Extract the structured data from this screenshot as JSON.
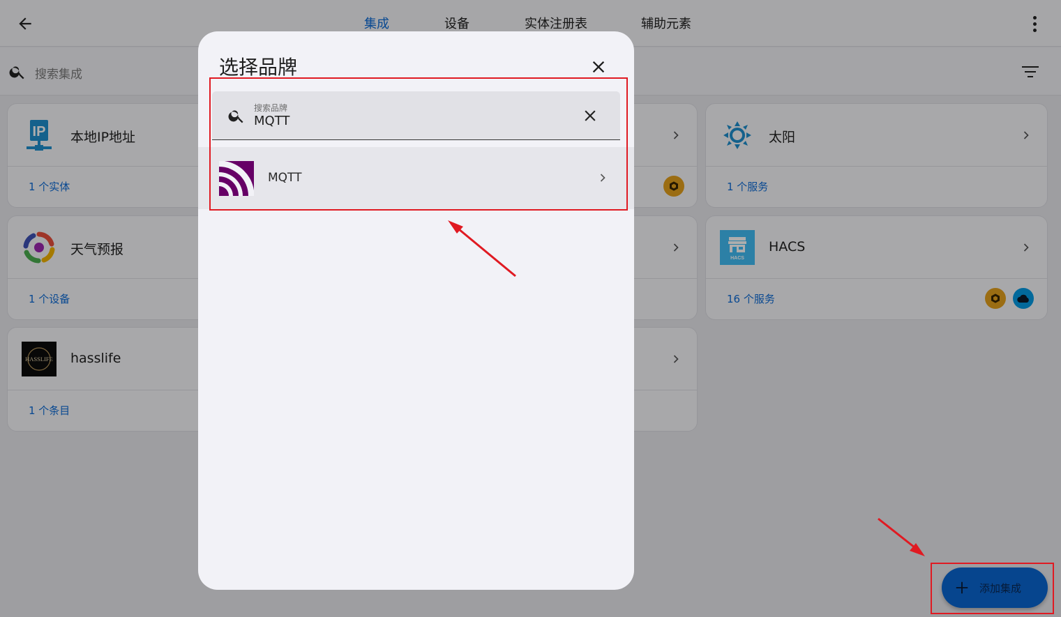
{
  "header": {
    "tabs": [
      {
        "label": "集成",
        "active": true
      },
      {
        "label": "设备",
        "active": false
      },
      {
        "label": "实体注册表",
        "active": false
      },
      {
        "label": "辅助元素",
        "active": false
      }
    ]
  },
  "search": {
    "placeholder": "搜索集成"
  },
  "cards": [
    {
      "title": "本地IP地址",
      "info": "1 个实体",
      "logo": "ip-address-icon"
    },
    {
      "title": "天气预报",
      "info": "1 个设备",
      "logo": "weather-forecast-icon"
    },
    {
      "title": "hasslife",
      "info": "1 个条目",
      "logo": "hasslife-logo"
    },
    {
      "title": "太阳",
      "info": "1 个服务",
      "logo": "sun-icon"
    },
    {
      "title": "HACS",
      "info": "16 个服务",
      "logo": "hacs-logo",
      "logo_text": "HACS"
    }
  ],
  "hasslife_logo_text": "HASSLIFE",
  "fab": {
    "label": "添加集成"
  },
  "dialog": {
    "title": "选择品牌",
    "search_label": "搜索品牌",
    "search_value": "MQTT",
    "results": [
      {
        "name": "MQTT",
        "logo": "mqtt-logo"
      }
    ]
  },
  "colors": {
    "accent": "#0d6bd6",
    "mqtt": "#660066",
    "badge_custom": "#e5a11c",
    "badge_cloud": "#039be5",
    "annotation": "#e01a22"
  }
}
